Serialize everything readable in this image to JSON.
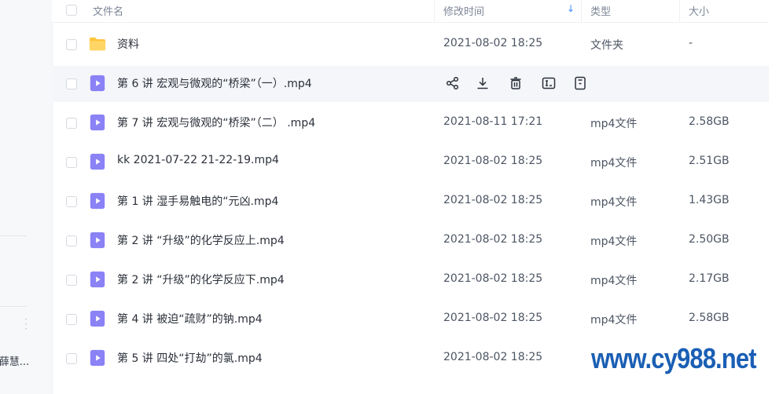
{
  "sidebar": {
    "user_label": "-薛慧..."
  },
  "header": {
    "name_label": "文件名",
    "date_label": "修改时间",
    "type_label": "类型",
    "size_label": "大小"
  },
  "rows": [
    {
      "name": "资料",
      "date": "2021-08-02 18:25",
      "type": "文件夹",
      "size": "-",
      "icon": "folder-icon",
      "color": "#ffc53d"
    },
    {
      "name": "第 6 讲  宏观与微观的“桥梁”（一）.mp4",
      "date": "",
      "type": "",
      "size": "",
      "icon": "video-file-icon",
      "hover": true
    },
    {
      "name": "第 7 讲  宏观与微观的“桥梁”（二） .mp4",
      "date": "2021-08-11 17:21",
      "type": "mp4文件",
      "size": "2.58GB",
      "icon": "video-file-icon"
    },
    {
      "name": "kk 2021-07-22 21-22-19.mp4",
      "date": "2021-08-02 18:25",
      "type": "mp4文件",
      "size": "2.51GB",
      "icon": "video-file-icon"
    },
    {
      "name": "第 1 讲  湿手易触电的“元凶.mp4",
      "date": "2021-08-02 18:25",
      "type": "mp4文件",
      "size": "1.43GB",
      "icon": "video-file-icon"
    },
    {
      "name": "第 2 讲  “升级”的化学反应上.mp4",
      "date": "2021-08-02 18:25",
      "type": "mp4文件",
      "size": "2.50GB",
      "icon": "video-file-icon"
    },
    {
      "name": "第 2 讲  “升级”的化学反应下.mp4",
      "date": "2021-08-02 18:25",
      "type": "mp4文件",
      "size": "2.17GB",
      "icon": "video-file-icon"
    },
    {
      "name": "第 4 讲  被迫“疏财”的钠.mp4",
      "date": "2021-08-02 18:25",
      "type": "mp4文件",
      "size": "2.58GB",
      "icon": "video-file-icon"
    },
    {
      "name": "第 5 讲  四处“打劫”的氯.mp4",
      "date": "2021-08-02 18:25",
      "type": "",
      "size": "",
      "icon": "video-file-icon"
    }
  ],
  "hover_actions": [
    "share-icon",
    "download-icon",
    "delete-icon",
    "rename-icon",
    "more-icon"
  ],
  "watermark": "www.cy988.net",
  "colors": {
    "accent": "#3a8bff",
    "video_icon": "#8a82f5",
    "folder": "#ffc53d",
    "watermark": "#1a5fb4"
  }
}
